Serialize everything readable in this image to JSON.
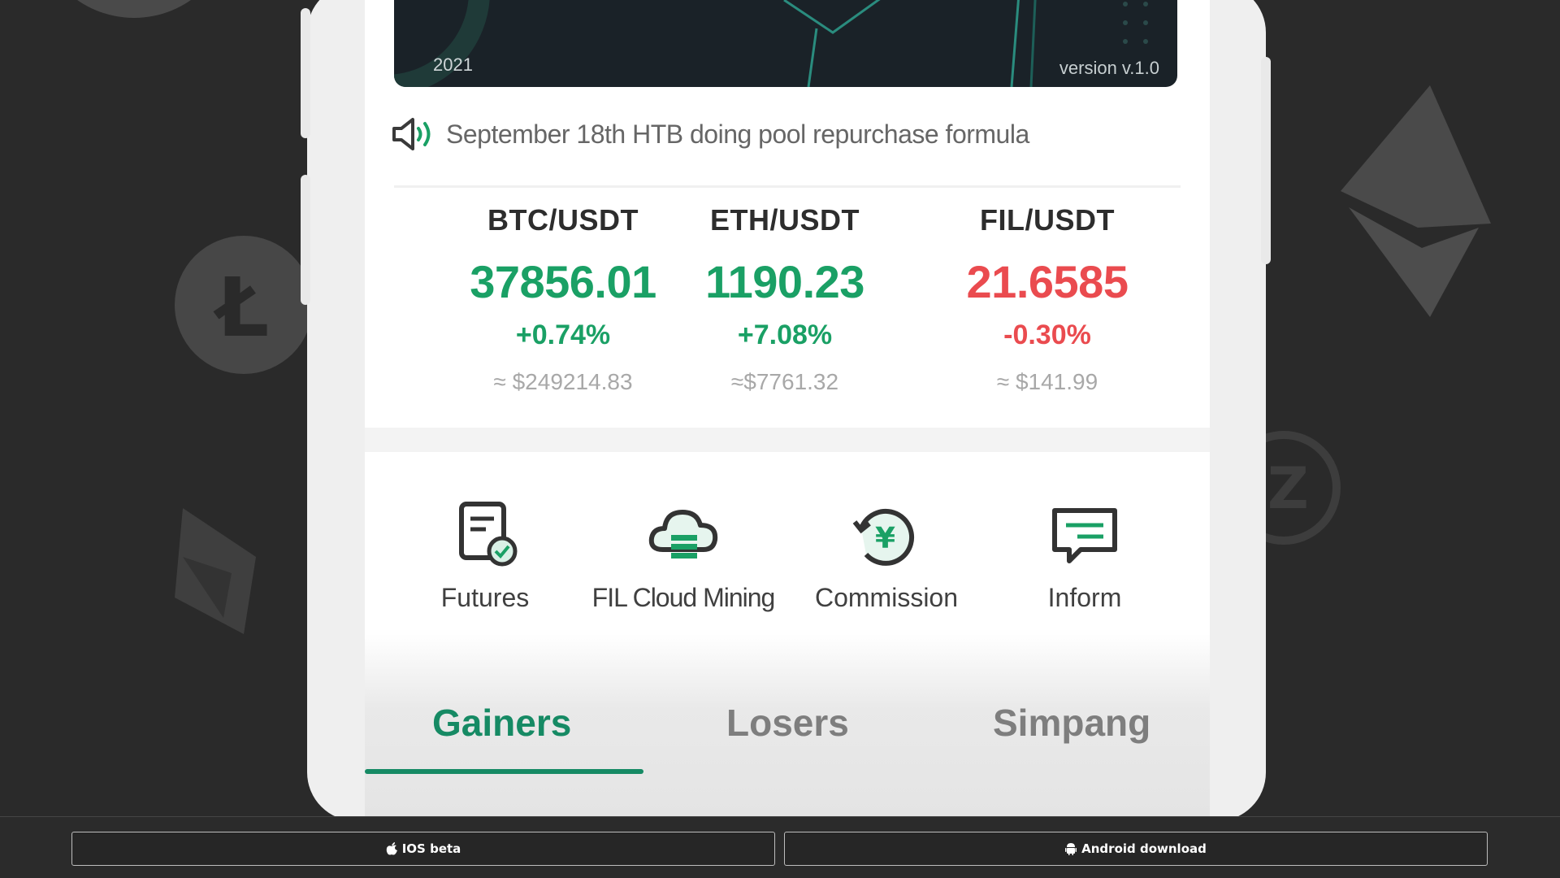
{
  "banner": {
    "year": "2021",
    "version": "version v.1.0"
  },
  "notice": {
    "text": "September 18th HTB doing pool repurchase formula"
  },
  "tickers": [
    {
      "pair": "BTC/USDT",
      "price": "37856.01",
      "change": "+0.74%",
      "usd": "≈ $249214.83",
      "trend": "up"
    },
    {
      "pair": "ETH/USDT",
      "price": "1190.23",
      "change": "+7.08%",
      "usd": "≈$7761.32",
      "trend": "up"
    },
    {
      "pair": "FIL/USDT",
      "price": "21.6585",
      "change": "-0.30%",
      "usd": "≈ $141.99",
      "trend": "down"
    }
  ],
  "quick_nav": [
    {
      "label": "Futures",
      "icon": "document-check-icon"
    },
    {
      "label": "FIL Cloud Mining",
      "icon": "cloud-server-icon"
    },
    {
      "label": "Commission",
      "icon": "yuan-refresh-icon"
    },
    {
      "label": "Inform",
      "icon": "message-icon"
    }
  ],
  "tabs": [
    {
      "label": "Gainers",
      "active": true
    },
    {
      "label": "Losers",
      "active": false
    },
    {
      "label": "Simpang",
      "active": false
    }
  ],
  "downloads": {
    "ios_label": "IOS beta",
    "android_label": "Android download"
  },
  "colors": {
    "accent": "#168a64",
    "up": "#1aa065",
    "down": "#ea4b4f",
    "background": "#2a2a2a"
  }
}
